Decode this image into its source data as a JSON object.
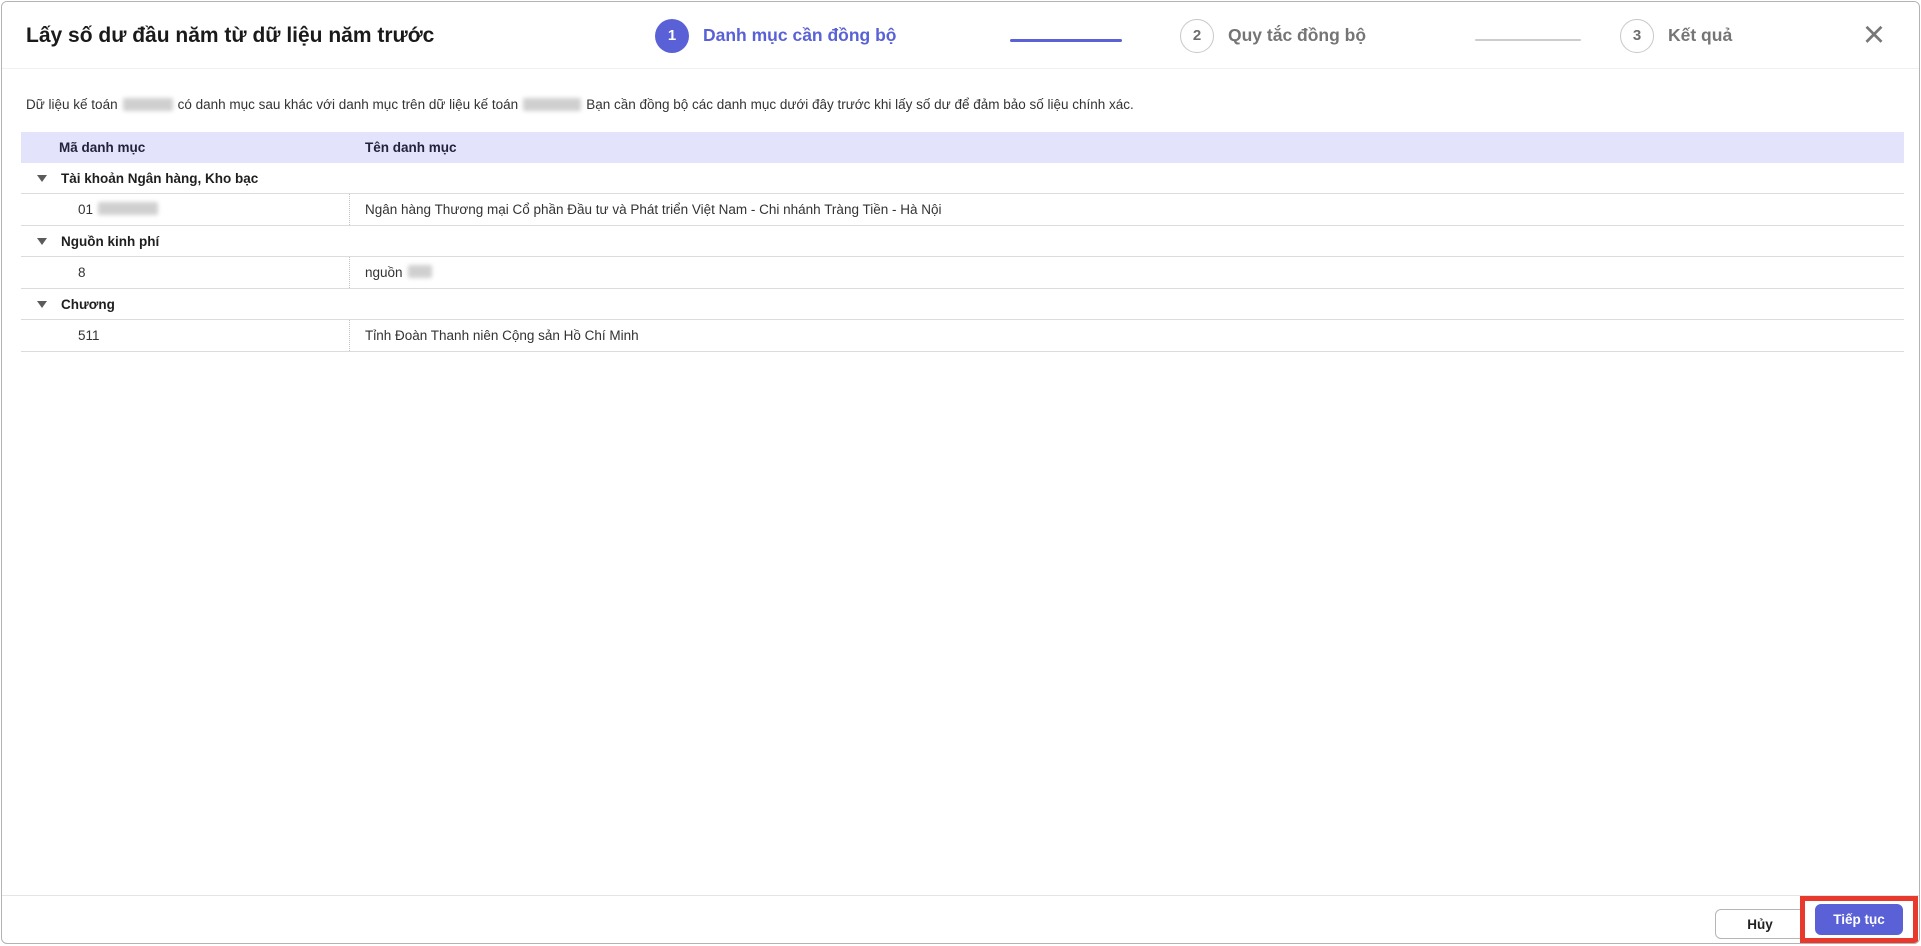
{
  "dialog": {
    "title": "Lấy số dư đầu năm từ dữ liệu năm trước"
  },
  "icons": {
    "close": "×"
  },
  "stepper": {
    "steps": [
      {
        "number": "1",
        "label": "Danh mục cần đồng bộ",
        "active": true
      },
      {
        "number": "2",
        "label": "Quy tắc đồng bộ",
        "active": false
      },
      {
        "number": "3",
        "label": "Kết quả",
        "active": false
      }
    ]
  },
  "description": {
    "text1": "Dữ liệu kế toán",
    "redacted1": "[ẩn]",
    "text2": "có danh mục sau khác với danh mục trên dữ liệu kế toán",
    "redacted2": "[ẩn]",
    "text3": "Bạn cần đồng bộ các danh mục dưới đây trước khi lấy số dư để đảm bảo số liệu chính xác."
  },
  "table": {
    "header": [
      "Mã danh mục",
      "Tên danh mục"
    ],
    "groups": [
      {
        "label": "Tài khoản Ngân hàng, Kho bạc",
        "rows": [
          {
            "code": "01",
            "code_redacted": true,
            "name": "Ngân hàng Thương mại Cổ phần Đầu tư và Phát triển Việt Nam - Chi nhánh Tràng Tiền - Hà Nội",
            "name_redacted": false
          }
        ]
      },
      {
        "label": "Nguồn kinh phí",
        "rows": [
          {
            "code": "8",
            "code_redacted": false,
            "name": "nguồn",
            "name_redacted": true
          }
        ]
      },
      {
        "label": "Chương",
        "rows": [
          {
            "code": "511",
            "code_redacted": false,
            "name": "Tỉnh Đoàn Thanh niên Cộng sản Hồ Chí Minh",
            "name_redacted": false
          }
        ]
      }
    ]
  },
  "footer": {
    "cancel_label": "Hủy",
    "continue_label": "Tiếp tục"
  },
  "colors": {
    "accent": "#5a61d6",
    "table_header_bg": "#e3e3fb",
    "annotation_red": "#e9382c",
    "inactive_step": "#757575"
  }
}
